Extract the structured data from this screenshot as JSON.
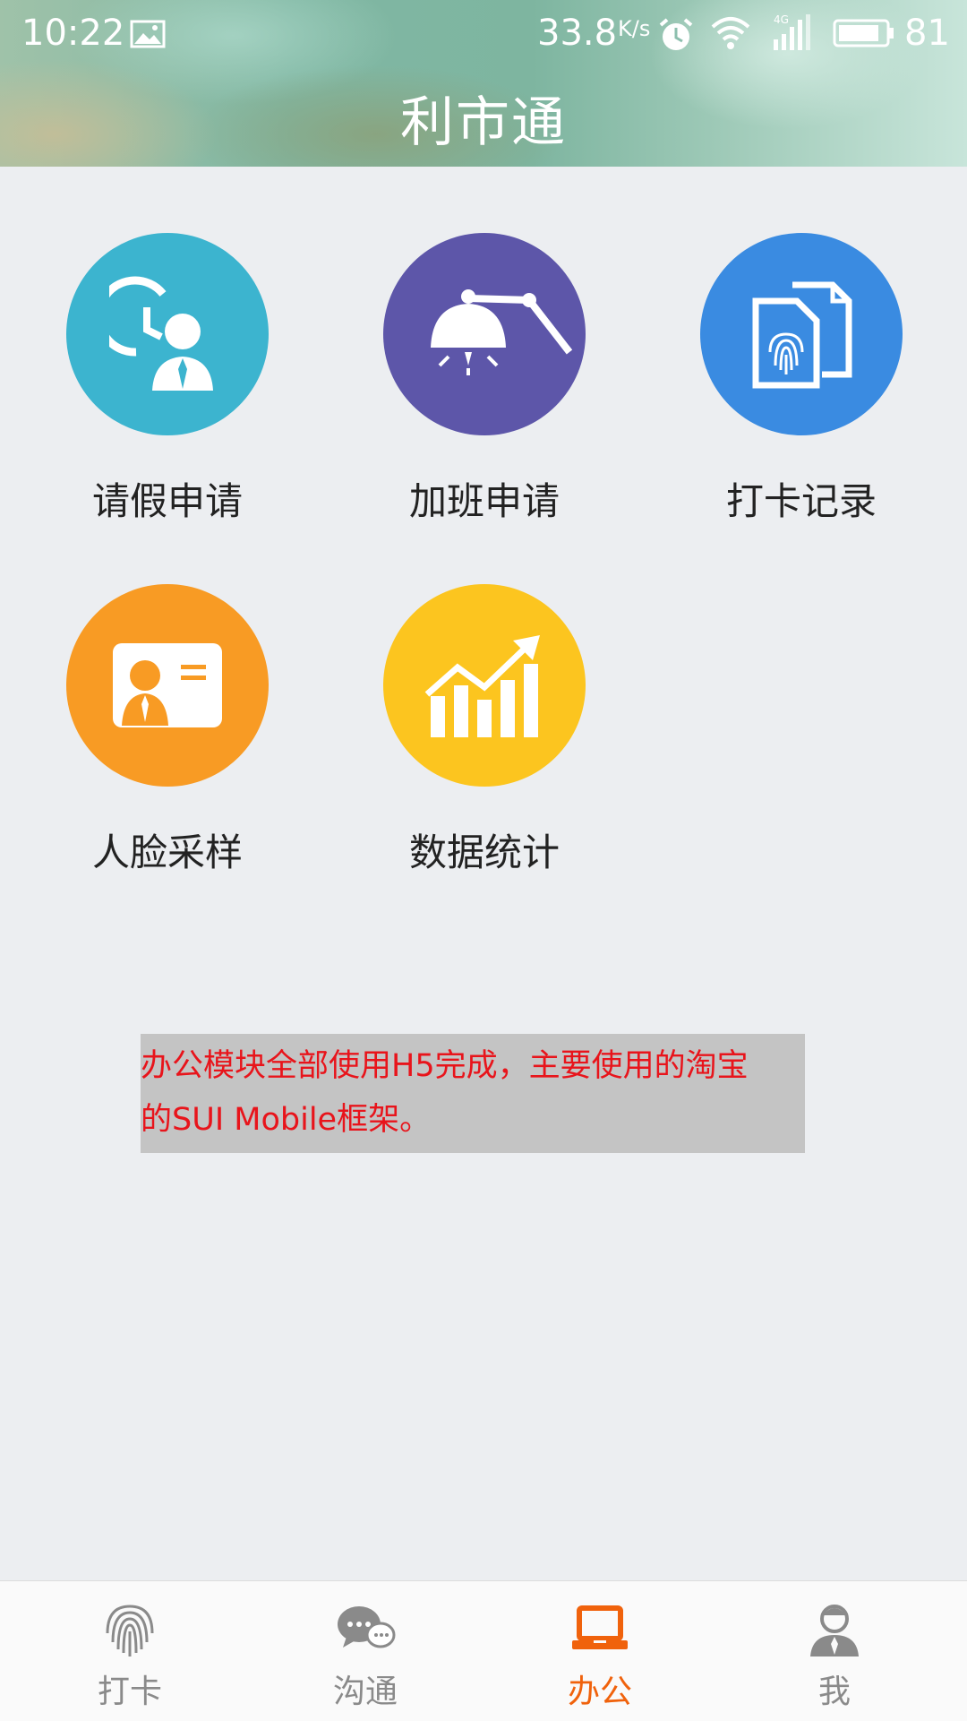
{
  "status_bar": {
    "time": "10:22",
    "speed": "33.8",
    "speed_unit": "K/s",
    "network": "4G",
    "battery": "81"
  },
  "header": {
    "title": "利市通"
  },
  "grid": {
    "items": [
      {
        "label": "请假申请",
        "icon": "leave-clock-person-icon",
        "color": "#3cb4cf"
      },
      {
        "label": "加班申请",
        "icon": "desk-lamp-icon",
        "color": "#5d56a9"
      },
      {
        "label": "打卡记录",
        "icon": "fingerprint-document-icon",
        "color": "#3a8be1"
      },
      {
        "label": "人脸采样",
        "icon": "id-card-person-icon",
        "color": "#f89b24"
      },
      {
        "label": "数据统计",
        "icon": "bar-chart-trend-icon",
        "color": "#fcc51f"
      }
    ]
  },
  "note": {
    "line1": "办公模块全部使用H5完成，主要使用的淘宝",
    "line2": "的SUI Mobile框架。",
    "text_color": "#e8141b",
    "background": "#c4c4c4"
  },
  "tabbar": {
    "active_color": "#f0620c",
    "tabs": [
      {
        "label": "打卡",
        "icon": "fingerprint-icon"
      },
      {
        "label": "沟通",
        "icon": "chat-bubbles-icon"
      },
      {
        "label": "办公",
        "icon": "laptop-icon",
        "active": true
      },
      {
        "label": "我",
        "icon": "person-icon"
      }
    ]
  }
}
